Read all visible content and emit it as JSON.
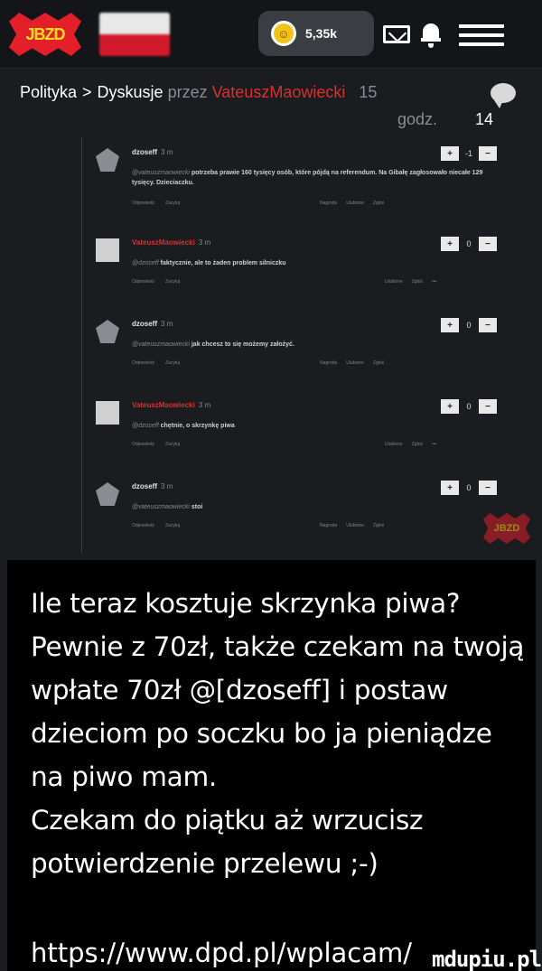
{
  "header": {
    "logo_text": "JBZD",
    "coins": "5,35k",
    "coin_symbol": "☺",
    "icons": [
      "jbzd-logo-icon",
      "flag-icon",
      "coin-icon",
      "mail-icon",
      "bell-icon",
      "menu-icon"
    ]
  },
  "breadcrumb": {
    "section": "Polityka",
    "sep1": ">",
    "subsection": "Dyskusje",
    "by": "przez",
    "author": "VateuszMaowiecki",
    "age_value": "15",
    "age_unit": "godz.",
    "comment_count": "14"
  },
  "comments": [
    {
      "user": "dzoseff",
      "ago": "3 m",
      "mention": "@vateuszmaowiecki",
      "text": "potrzeba prawie 160 tysięcy osób, które pójdą na referendum. Na Gibałę zagłosowało niecałe 129 tysięcy. Dzieciaczku.",
      "score": "-1",
      "reply": "Odpowiedz",
      "block": "Zacytuj",
      "reward": "Nagroda",
      "fav": "Ulubione",
      "report": "Zgłoś"
    },
    {
      "user": "VateuszMaowiecki",
      "ago": "3 m",
      "mention": "@dzoseff",
      "text": "faktycznie, ale to żaden problem silniczku",
      "score": "0",
      "reply": "Odpowiedz",
      "block": "Zacytuj",
      "fav": "Ulubione",
      "report": "Zgłoś",
      "more": "•••"
    },
    {
      "user": "dzoseff",
      "ago": "3 m",
      "mention": "@vateuszmaowiecki",
      "text": "jak chcesz to się możemy założyć.",
      "score": "0",
      "reply": "Odpowiedz",
      "block": "Zacytuj",
      "reward": "Nagroda",
      "fav": "Ulubione",
      "report": "Zgłoś"
    },
    {
      "user": "VateuszMaowiecki",
      "ago": "3 m",
      "mention": "@dzoseff",
      "text": "chętnie, o skrzynkę piwa",
      "score": "0",
      "reply": "Odpowiedz",
      "block": "Zacytuj",
      "fav": "Ulubione",
      "report": "Zgłoś",
      "more": "•••"
    },
    {
      "user": "dzoseff",
      "ago": "3 m",
      "mention": "@vateuszmaowiecki",
      "text": "stoi",
      "score": "0",
      "reply": "Odpowiedz",
      "block": "Zacytuj",
      "reward": "Nagroda",
      "fav": "Ulubione",
      "report": "Zgłoś"
    }
  ],
  "vote": {
    "plus": "+",
    "minus": "−"
  },
  "watermark": "JBZD",
  "caption": {
    "lines": [
      "Ile teraz kosztuje skrzynka piwa?",
      "Pewnie z 70zł, także czekam na twoją",
      "wpłate 70zł @[dzoseff] i postaw",
      "dzieciom po soczku bo ja pieniądze",
      "na piwo mam.",
      "Czekam do piątku aż wrzucisz",
      "potwierdzenie przelewu ;-)"
    ],
    "url": "https://www.dpd.pl/wplacam/",
    "site": "mdupiu.pl"
  },
  "colors": {
    "accent_red": "#d4332f",
    "logo_red": "#e3202a",
    "logo_yellow": "#ffe21a",
    "coin": "#f2c21a"
  }
}
